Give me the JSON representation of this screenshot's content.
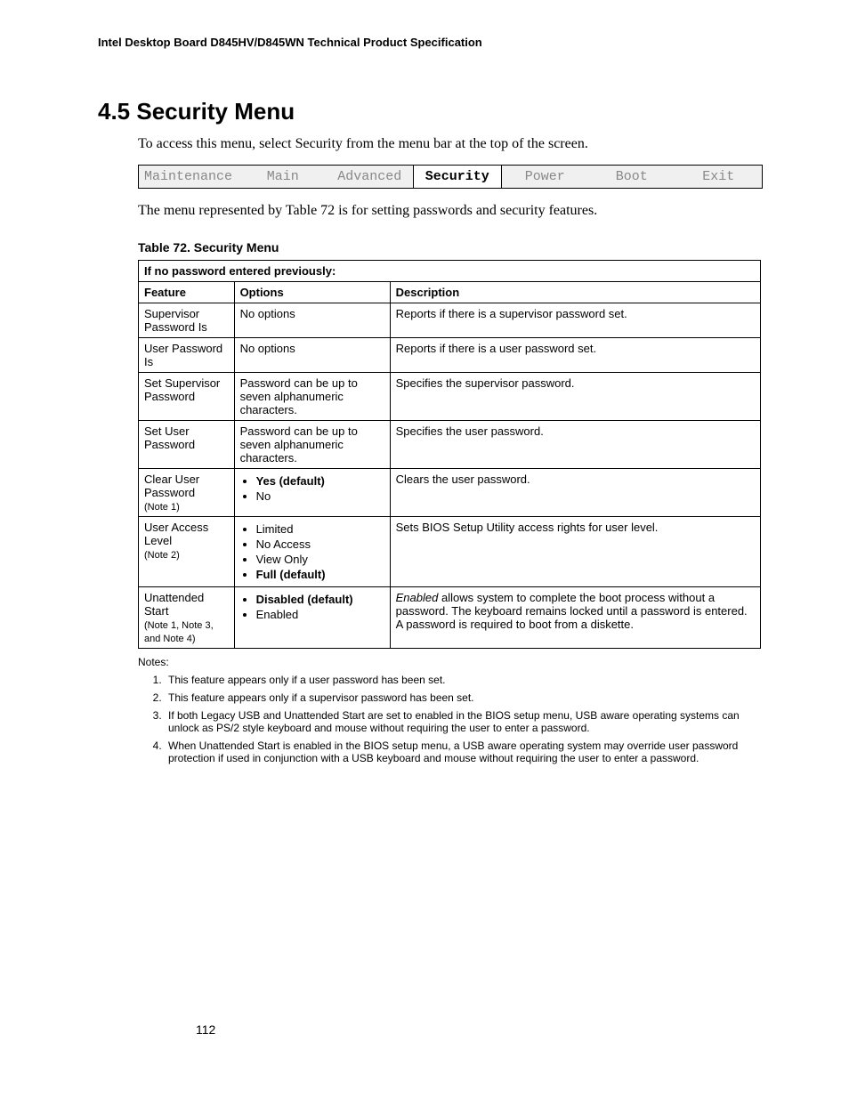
{
  "header": "Intel Desktop Board D845HV/D845WN Technical Product Specification",
  "section_title": "4.5  Security Menu",
  "intro": "To access this menu, select Security from the menu bar at the top of the screen.",
  "menubar": {
    "items": [
      "Maintenance",
      "Main",
      "Advanced",
      "Security",
      "Power",
      "Boot",
      "Exit"
    ],
    "selected_index": 3
  },
  "caption": "The menu represented by Table 72 is for setting passwords and security features.",
  "table_title": "Table 72.    Security Menu",
  "banner": "If no password entered previously:",
  "columns": [
    "Feature",
    "Options",
    "Description"
  ],
  "rows": [
    {
      "feature": "Supervisor Password Is",
      "note": "",
      "options_text": "No options",
      "options_list": [],
      "description": "Reports if there is a supervisor password set."
    },
    {
      "feature": "User Password Is",
      "note": "",
      "options_text": "No options",
      "options_list": [],
      "description": "Reports if there is a user password set."
    },
    {
      "feature": "Set Supervisor Password",
      "note": "",
      "options_text": "Password can be up to seven alphanumeric characters.",
      "options_list": [],
      "description": "Specifies the supervisor password."
    },
    {
      "feature": "Set User Password",
      "note": "",
      "options_text": "Password can be up to seven alphanumeric characters.",
      "options_list": [],
      "description": "Specifies the user password."
    },
    {
      "feature": "Clear User Password",
      "note": "(Note 1)",
      "options_text": "",
      "options_list": [
        {
          "label": "Yes (default)",
          "bold": true
        },
        {
          "label": "No",
          "bold": false
        }
      ],
      "description": "Clears the user password."
    },
    {
      "feature": "User Access Level",
      "note": "(Note 2)",
      "options_text": "",
      "options_list": [
        {
          "label": "Limited",
          "bold": false
        },
        {
          "label": "No Access",
          "bold": false
        },
        {
          "label": "View Only",
          "bold": false
        },
        {
          "label": "Full (default)",
          "bold": true
        }
      ],
      "description": "Sets BIOS Setup Utility access rights for user level."
    },
    {
      "feature": "Unattended Start",
      "note": "(Note 1, Note 3, and Note 4)",
      "options_text": "",
      "options_list": [
        {
          "label": "Disabled (default)",
          "bold": true
        },
        {
          "label": "Enabled",
          "bold": false
        }
      ],
      "description_html": "<i>Enabled</i> allows system to complete the boot process without a password.  The keyboard remains locked until a password is entered.  A password is required to boot from a diskette."
    }
  ],
  "notes_label": "Notes:",
  "notes": [
    "This feature appears only if a user password has been set.",
    "This feature appears only if a supervisor password has been set.",
    "If both Legacy USB and Unattended Start are set to enabled in the BIOS setup menu, USB aware operating systems can unlock as PS/2 style keyboard and mouse without requiring the user to enter a password.",
    "When Unattended Start is enabled in the BIOS setup menu, a USB aware operating system may override user password protection if used in conjunction with a USB keyboard and mouse without requiring the user to enter a password."
  ],
  "page_number": "112"
}
